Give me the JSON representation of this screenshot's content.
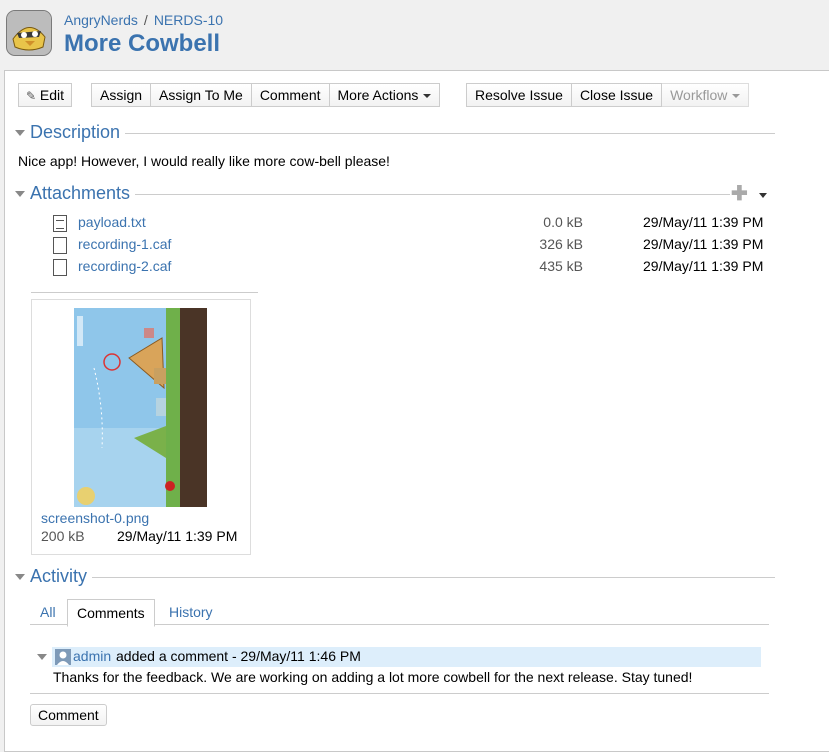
{
  "breadcrumb": {
    "project": "AngryNerds",
    "issue_key": "NERDS-10"
  },
  "page_title": "More Cowbell",
  "toolbar": {
    "edit": "Edit",
    "assign": "Assign",
    "assign_to_me": "Assign To Me",
    "comment": "Comment",
    "more_actions": "More Actions",
    "resolve": "Resolve Issue",
    "close": "Close Issue",
    "workflow": "Workflow"
  },
  "description": {
    "title": "Description",
    "text": "Nice app! However, I would really like more cow-bell please!"
  },
  "attachments": {
    "title": "Attachments",
    "files": [
      {
        "name": "payload.txt",
        "size": "0.0 kB",
        "date": "29/May/11 1:39 PM"
      },
      {
        "name": "recording-1.caf",
        "size": "326 kB",
        "date": "29/May/11 1:39 PM"
      },
      {
        "name": "recording-2.caf",
        "size": "435 kB",
        "date": "29/May/11 1:39 PM"
      }
    ],
    "image": {
      "name": "screenshot-0.png",
      "size": "200 kB",
      "date": "29/May/11 1:39 PM"
    }
  },
  "activity": {
    "title": "Activity",
    "tabs": [
      "All",
      "Comments",
      "History"
    ],
    "active_tab": "Comments",
    "comment": {
      "author": "admin",
      "meta": "added a comment - 29/May/11 1:46 PM",
      "text": "Thanks for the feedback. We are working on adding a lot more cowbell for the next release. Stay tuned!"
    },
    "comment_button": "Comment"
  },
  "colors": {
    "link": "#3b73af",
    "comment_header_bg": "#ddeefb"
  }
}
